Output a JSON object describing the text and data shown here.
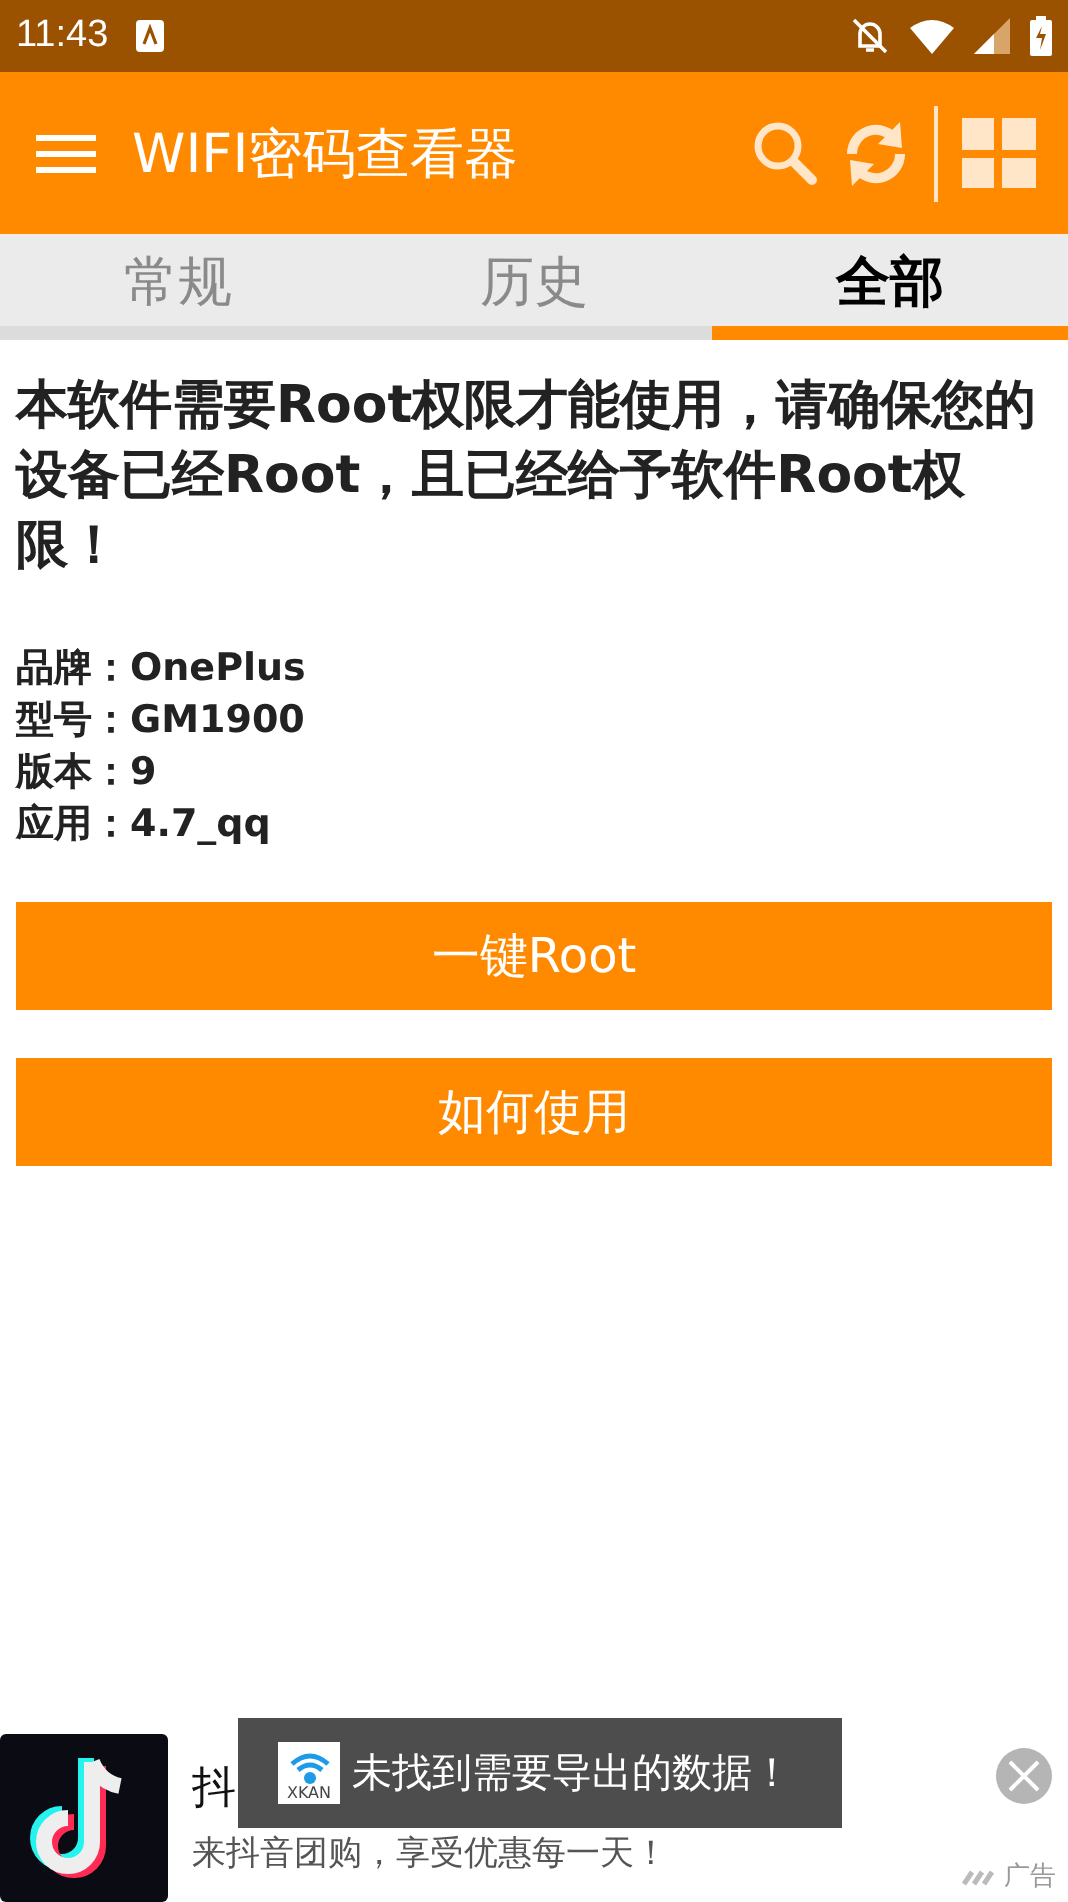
{
  "status_bar": {
    "time": "11:43"
  },
  "toolbar": {
    "title": "WIFI密码查看器"
  },
  "tabs": [
    {
      "label": "常规",
      "selected": false
    },
    {
      "label": "历史",
      "selected": false
    },
    {
      "label": "全部",
      "selected": true
    }
  ],
  "notice": "本软件需要Root权限才能使用，请确保您的设备已经Root，且已经给予软件Root权限！",
  "device_info": [
    {
      "label": "品牌：",
      "value": "OnePlus"
    },
    {
      "label": "型号：",
      "value": "GM1900"
    },
    {
      "label": "版本：",
      "value": "9"
    },
    {
      "label": "应用：",
      "value": "4.7_qq"
    }
  ],
  "buttons": [
    "一键Root",
    "如何使用"
  ],
  "ad": {
    "title": "抖",
    "description": "来抖音团购，享受优惠每一天！",
    "tag": "广告"
  },
  "toast": {
    "icon_label": "XKAN",
    "message": "未找到需要导出的数据！"
  }
}
